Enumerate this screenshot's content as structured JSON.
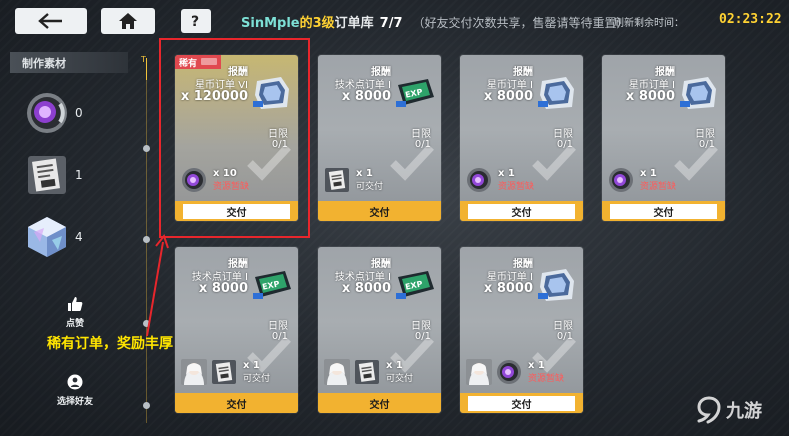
{
  "header": {
    "username": "SinMple",
    "title_level_part": "的3级",
    "title_rest": "订单库",
    "order_count": "7/7",
    "note": "（好友交付次数共享，售罄请等待重置）",
    "refresh_label": "刷新剩余时间：",
    "refresh_time": "02:23:22"
  },
  "sidebar": {
    "materials_title": "制作素材",
    "materials": [
      {
        "icon": "purple-orb-icon",
        "count": "0"
      },
      {
        "icon": "document-item-icon",
        "count": "1"
      },
      {
        "icon": "crystal-cube-icon",
        "count": "4"
      }
    ],
    "like_label": "点赞",
    "select_friend_label": "选择好友"
  },
  "timeline": {
    "top_marker": "T"
  },
  "annotation": "稀有订单，奖励丰厚",
  "orders": [
    {
      "rare": true,
      "rare_label": "稀有",
      "reward_header": "报酬",
      "reward_name": "星币订单 VI",
      "reward_qty": "x 120000",
      "reward_icon": "coin-crate-icon",
      "limit_label": "日限",
      "limit_value": "0/1",
      "req_icon": "purple-orb-icon",
      "req_qty": "x 10",
      "req_status": "资源暂缺",
      "req_ok": false,
      "button": "交付",
      "button_disabled": true
    },
    {
      "rare": false,
      "reward_header": "报酬",
      "reward_name": "技术点订单 I",
      "reward_qty": "x 8000",
      "reward_icon": "exp-chip-icon",
      "limit_label": "日限",
      "limit_value": "0/1",
      "req_icon": "document-item-icon",
      "req_qty": "x 1",
      "req_status": "可交付",
      "req_ok": true,
      "button": "交付",
      "button_disabled": false
    },
    {
      "rare": false,
      "reward_header": "报酬",
      "reward_name": "星币订单 I",
      "reward_qty": "x 8000",
      "reward_icon": "coin-crate-icon",
      "limit_label": "日限",
      "limit_value": "0/1",
      "req_icon": "purple-orb-icon",
      "req_qty": "x 1",
      "req_status": "资源暂缺",
      "req_ok": false,
      "button": "交付",
      "button_disabled": true
    },
    {
      "rare": false,
      "reward_header": "报酬",
      "reward_name": "星币订单 I",
      "reward_qty": "x 8000",
      "reward_icon": "coin-crate-icon",
      "limit_label": "日限",
      "limit_value": "0/1",
      "req_icon": "purple-orb-icon",
      "req_qty": "x 1",
      "req_status": "资源暂缺",
      "req_ok": false,
      "button": "交付",
      "button_disabled": true
    },
    {
      "rare": false,
      "reward_header": "报酬",
      "reward_name": "技术点订单 I",
      "reward_qty": "x 8000",
      "reward_icon": "exp-chip-icon",
      "limit_label": "日限",
      "limit_value": "0/1",
      "req_icon": "document-item-icon",
      "req_qty": "x 1",
      "req_status": "可交付",
      "req_ok": true,
      "has_avatar": true,
      "button": "交付",
      "button_disabled": false
    },
    {
      "rare": false,
      "reward_header": "报酬",
      "reward_name": "技术点订单 I",
      "reward_qty": "x 8000",
      "reward_icon": "exp-chip-icon",
      "limit_label": "日限",
      "limit_value": "0/1",
      "req_icon": "document-item-icon",
      "req_qty": "x 1",
      "req_status": "可交付",
      "req_ok": true,
      "has_avatar": true,
      "button": "交付",
      "button_disabled": false
    },
    {
      "rare": false,
      "reward_header": "报酬",
      "reward_name": "星币订单 I",
      "reward_qty": "x 8000",
      "reward_icon": "coin-crate-icon",
      "limit_label": "日限",
      "limit_value": "0/1",
      "req_icon": "purple-orb-icon",
      "req_qty": "x 1",
      "req_status": "资源暂缺",
      "req_ok": false,
      "has_avatar": true,
      "button": "交付",
      "button_disabled": true
    }
  ],
  "watermark": {
    "brand": "九游"
  }
}
